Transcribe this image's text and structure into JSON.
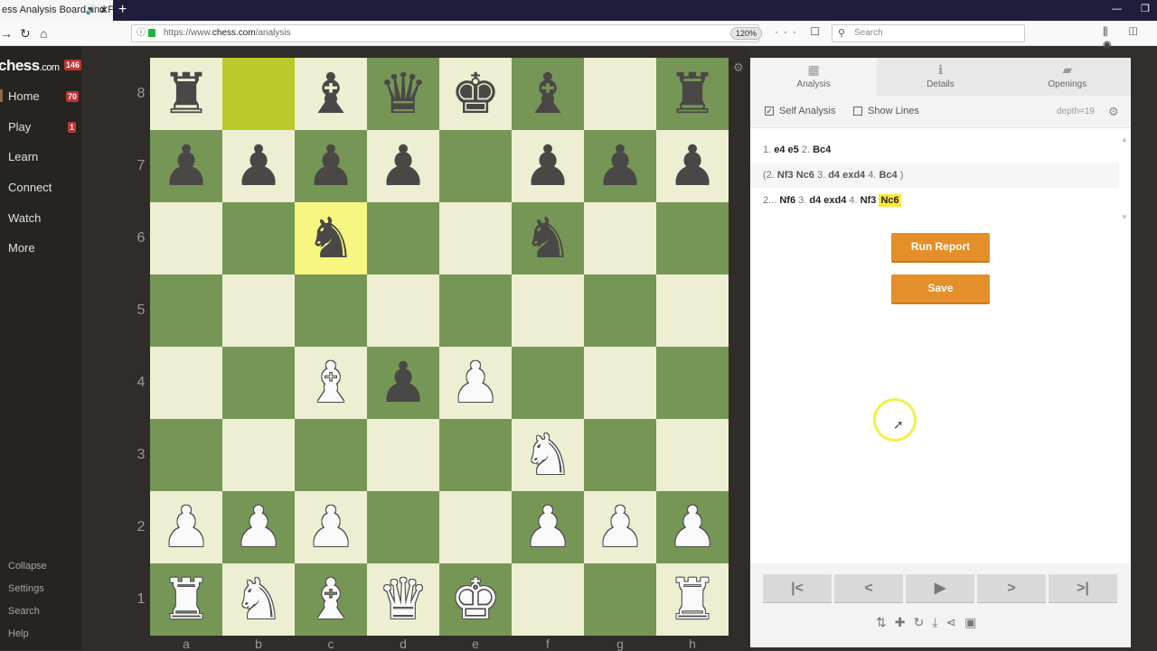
{
  "browser": {
    "tab_title": "ess Analysis Board and P",
    "new_tab": "+",
    "url_domain": "chess.com",
    "url_prefix": "https://www.",
    "url_path": "/analysis",
    "zoom_level": "120%",
    "search_placeholder": "Search",
    "page_actions": "··· ☐ ☆",
    "tools": "⫼ ◫ ◉"
  },
  "sidebar": {
    "logo": "chess",
    "logo_suffix": ".com",
    "logo_badge": "146",
    "items": [
      {
        "label": "Home",
        "badge": "70"
      },
      {
        "label": "Play",
        "badge": "1"
      },
      {
        "label": "Learn",
        "badge": ""
      },
      {
        "label": "Connect",
        "badge": ""
      },
      {
        "label": "Watch",
        "badge": ""
      },
      {
        "label": "More",
        "badge": ""
      }
    ],
    "footer": [
      "Collapse",
      "Settings",
      "Search",
      "Help"
    ]
  },
  "board": {
    "ranks": [
      "8",
      "7",
      "6",
      "5",
      "4",
      "3",
      "2",
      "1"
    ],
    "files": [
      "a",
      "b",
      "c",
      "d",
      "e",
      "f",
      "g",
      "h"
    ],
    "position": [
      [
        "bR",
        "",
        "bB",
        "bQ",
        "bK",
        "bB",
        "",
        "bR"
      ],
      [
        "bP",
        "bP",
        "bP",
        "bP",
        "",
        "bP",
        "bP",
        "bP"
      ],
      [
        "",
        "",
        "bN",
        "",
        "",
        "bN",
        "",
        ""
      ],
      [
        "",
        "",
        "",
        "",
        "",
        "",
        "",
        ""
      ],
      [
        "",
        "",
        "wB",
        "bP",
        "wP",
        "",
        "",
        ""
      ],
      [
        "",
        "",
        "",
        "",
        "",
        "wN",
        "",
        ""
      ],
      [
        "wP",
        "wP",
        "wP",
        "",
        "",
        "wP",
        "wP",
        "wP"
      ],
      [
        "wR",
        "wN",
        "wB",
        "wQ",
        "wK",
        "",
        "",
        "wR"
      ]
    ],
    "highlighted_squares": [
      "b8",
      "c6"
    ],
    "colors": {
      "light": "#eeeed2",
      "dark": "#769656",
      "highlight": "#f6f680"
    }
  },
  "panel": {
    "tabs": [
      {
        "label": "Analysis",
        "icon": "analysis-icon",
        "active": true
      },
      {
        "label": "Details",
        "icon": "info-icon",
        "active": false
      },
      {
        "label": "Openings",
        "icon": "book-icon",
        "active": false
      }
    ],
    "self_analysis": {
      "label": "Self Analysis",
      "checked": true
    },
    "show_lines": {
      "label": "Show Lines",
      "checked": false
    },
    "depth": "depth=19",
    "moves": {
      "line1": [
        {
          "n": "1."
        },
        {
          "m": "e4"
        },
        {
          "m": "e5"
        },
        {
          "n": "2."
        },
        {
          "m": "Bc4"
        }
      ],
      "line2": [
        {
          "n": "(2."
        },
        {
          "m": "Nf3"
        },
        {
          "m": "Nc6"
        },
        {
          "n": "3."
        },
        {
          "m": "d4"
        },
        {
          "m": "exd4"
        },
        {
          "n": "4."
        },
        {
          "m": "Bc4"
        },
        {
          "n": ")"
        }
      ],
      "line3": [
        {
          "n": "2..."
        },
        {
          "m": "Nf6"
        },
        {
          "n": "3."
        },
        {
          "m": "d4"
        },
        {
          "m": "exd4"
        },
        {
          "n": "4."
        },
        {
          "m": "Nf3"
        },
        {
          "m": "Nc6",
          "current": true
        }
      ]
    },
    "run_report": "Run Report",
    "save": "Save",
    "nav": {
      "first": "|<",
      "prev": "<",
      "play": "▶",
      "next": ">",
      "last": ">|"
    },
    "accent_color": "#e58f2a"
  }
}
